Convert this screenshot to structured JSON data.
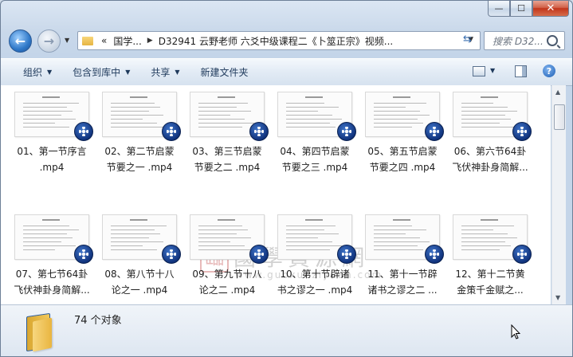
{
  "window": {
    "minimize_glyph": "—",
    "maximize_glyph": "☐",
    "close_glyph": "✕"
  },
  "nav": {
    "back_glyph": "←",
    "forward_glyph": "→",
    "breadcrumb_overflow": "«",
    "breadcrumb": [
      "国学...",
      "D32941  云野老师 六爻中级课程二《卜筮正宗》视频..."
    ],
    "search_placeholder": "搜索 D32..."
  },
  "toolbar": {
    "organize": "组织",
    "include_library": "包含到库中",
    "share": "共享",
    "new_folder": "新建文件夹"
  },
  "files": [
    {
      "line1": "01、第一节序言",
      "line2": ".mp4"
    },
    {
      "line1": "02、第二节启蒙",
      "line2": "节要之一 .mp4"
    },
    {
      "line1": "03、第三节启蒙",
      "line2": "节要之二 .mp4"
    },
    {
      "line1": "04、第四节启蒙",
      "line2": "节要之三 .mp4"
    },
    {
      "line1": "05、第五节启蒙",
      "line2": "节要之四 .mp4"
    },
    {
      "line1": "06、第六节64卦",
      "line2": "飞伏神卦身简解..."
    },
    {
      "line1": "07、第七节64卦",
      "line2": "飞伏神卦身简解..."
    },
    {
      "line1": "08、第八节十八",
      "line2": "论之一 .mp4"
    },
    {
      "line1": "09、第九节十八",
      "line2": "论之二 .mp4"
    },
    {
      "line1": "10、第十节辟诸",
      "line2": "书之谬之一 .mp4"
    },
    {
      "line1": "11、第十一节辟",
      "line2": "诸书之谬之二 ..."
    },
    {
      "line1": "12、第十二节黄",
      "line2": "金策千金赋之..."
    }
  ],
  "watermark": {
    "seal": "臨",
    "title": "國學資源網",
    "url": "www.guoxueziyuan.com"
  },
  "status": {
    "count": "74 个对象"
  },
  "colors": {
    "badge": "#1a3f8f",
    "toolbar_text": "#1e395b"
  }
}
